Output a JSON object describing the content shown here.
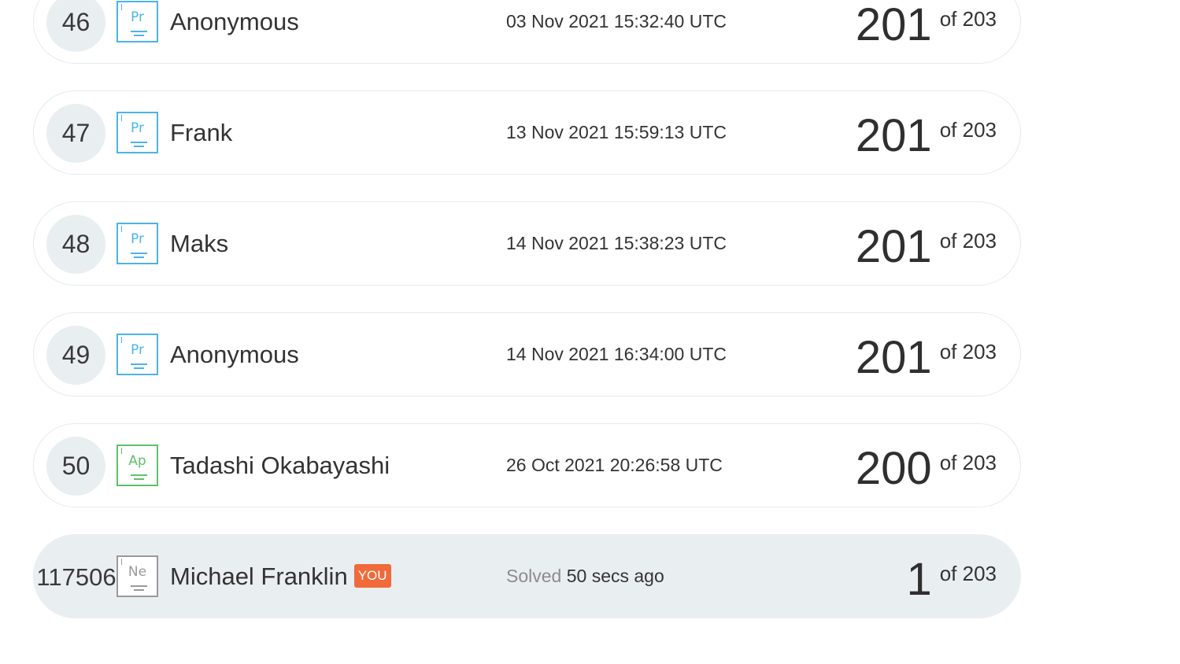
{
  "leaderboard": {
    "rows": [
      {
        "rank": "46",
        "badge": "Pr",
        "badge_color": "#4db3e6",
        "name": "Anonymous",
        "date": "03 Nov 2021 15:32:40 UTC",
        "score": "201",
        "of": "of 203"
      },
      {
        "rank": "47",
        "badge": "Pr",
        "badge_color": "#4db3e6",
        "name": "Frank",
        "date": "13 Nov 2021 15:59:13 UTC",
        "score": "201",
        "of": "of 203"
      },
      {
        "rank": "48",
        "badge": "Pr",
        "badge_color": "#4db3e6",
        "name": "Maks",
        "date": "14 Nov 2021 15:38:23 UTC",
        "score": "201",
        "of": "of 203"
      },
      {
        "rank": "49",
        "badge": "Pr",
        "badge_color": "#4db3e6",
        "name": "Anonymous",
        "date": "14 Nov 2021 16:34:00 UTC",
        "score": "201",
        "of": "of 203"
      },
      {
        "rank": "50",
        "badge": "Ap",
        "badge_color": "#5cc26a",
        "name": "Tadashi Okabayashi",
        "date": "26 Oct 2021 20:26:58 UTC",
        "score": "200",
        "of": "of 203"
      }
    ],
    "current_user": {
      "rank": "117506",
      "badge": "Ne",
      "badge_color": "#9a9a9a",
      "name": "Michael Franklin",
      "you_label": "YOU",
      "solved_label": "Solved",
      "solved_time": "50 secs ago",
      "score": "1",
      "of": "of 203"
    }
  },
  "colors": {
    "row_border": "#e6eaed",
    "highlight_bg": "#e9eef1",
    "you_tag": "#f16a3a"
  }
}
